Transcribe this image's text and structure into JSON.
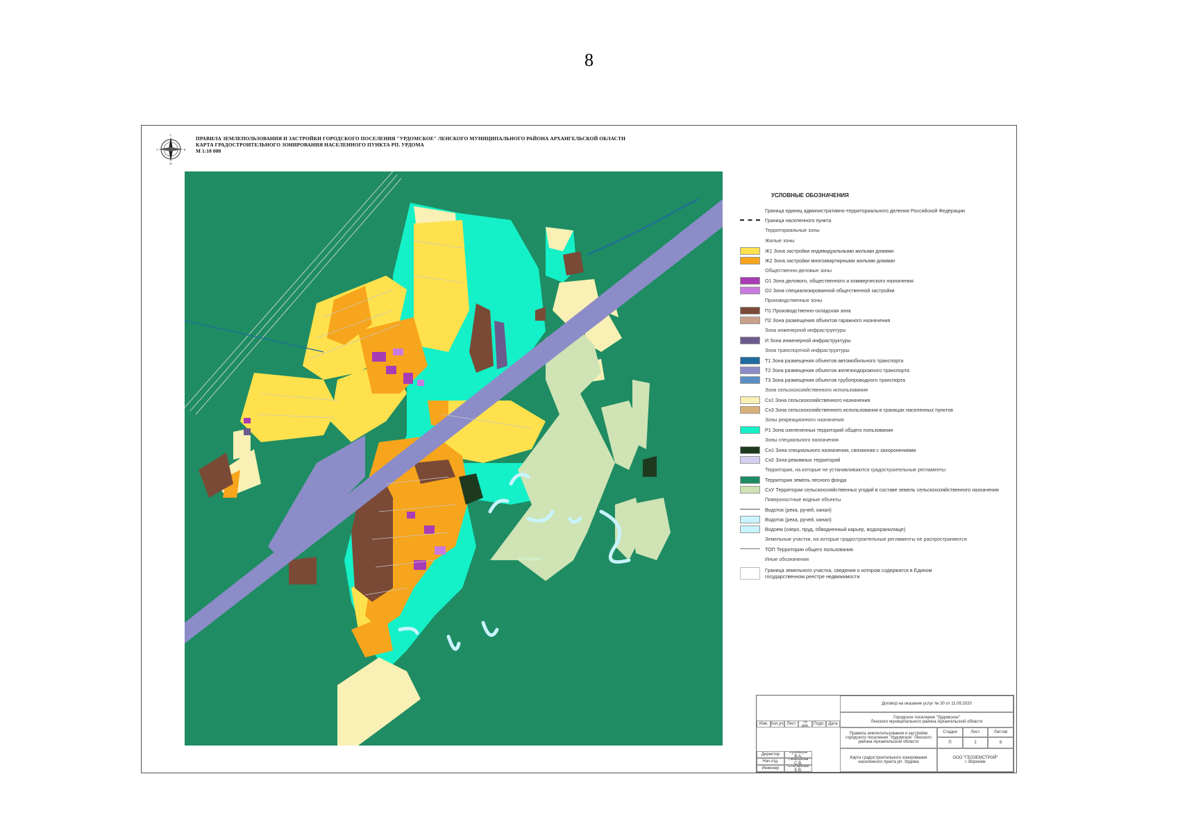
{
  "page_number": "8",
  "title_block": {
    "line1": "ПРАВИЛА ЗЕМЛЕПОЛЬЗОВАНИЯ И ЗАСТРОЙКИ ГОРОДСКОГО ПОСЕЛЕНИЯ \"УРДОМСКОЕ\" ЛЕНСКОГО МУНИЦИПАЛЬНОГО РАЙОНА АРХАНГЕЛЬСКОЙ ОБЛАСТИ",
    "line2": "КАРТА ГРАДОСТРОИТЕЛЬНОГО ЗОНИРОВАНИЯ НАСЕЛЕННОГО ПУНКТА РП. УРДОМА",
    "line3": "М 1:10 000"
  },
  "compass": {
    "n": "С",
    "s": "Ю",
    "e": "В",
    "w": "З"
  },
  "map_labels": {
    "river": "пос.Урдома"
  },
  "legend": {
    "title": "УСЛОВНЫЕ ОБОЗНАЧЕНИЯ",
    "rows": [
      {
        "kind": "line",
        "style": "admin",
        "text": "Граница единиц административно-территориального деления Российской Федерации"
      },
      {
        "kind": "line",
        "style": "settlement",
        "text": "Граница населенного пункта"
      },
      {
        "kind": "head",
        "text": "Территориальные зоны"
      },
      {
        "kind": "head",
        "text": "Жилые зоны"
      },
      {
        "kind": "swatch",
        "color": "#ffe14d",
        "text": "Ж1 Зона застройки индивидуальными жилыми домами"
      },
      {
        "kind": "swatch",
        "color": "#f7a51c",
        "text": "Ж2 Зона застройки многоквартирными жилыми домами"
      },
      {
        "kind": "head",
        "text": "Общественно-деловые зоны"
      },
      {
        "kind": "swatch",
        "color": "#a83cb4",
        "text": "О1 Зона делового, общественного и коммерческого назначения"
      },
      {
        "kind": "swatch",
        "color": "#c97ae0",
        "text": "О2 Зона специализированной общественной застройки"
      },
      {
        "kind": "head",
        "text": "Производственные зоны"
      },
      {
        "kind": "swatch",
        "color": "#7a4a36",
        "text": "П1 Производственно-складская зона"
      },
      {
        "kind": "swatch",
        "color": "#c9a088",
        "text": "П2 Зона размещения объектов гаражного назначения"
      },
      {
        "kind": "head",
        "text": "Зона инженерной инфраструктуры"
      },
      {
        "kind": "swatch",
        "color": "#6b5b8c",
        "text": "И Зона инженерной инфраструктуры"
      },
      {
        "kind": "head",
        "text": "Зона транспортной инфраструктуры"
      },
      {
        "kind": "swatch",
        "color": "#1f6b9e",
        "text": "Т1 Зона размещения объектов автомобильного транспорта"
      },
      {
        "kind": "swatch",
        "color": "#8c8cc8",
        "text": "Т2 Зона размещения объектов железнодорожного транспорта"
      },
      {
        "kind": "swatch",
        "color": "#5b8fc4",
        "text": "Т3 Зона размещения объектов трубопроводного транспорта"
      },
      {
        "kind": "head",
        "text": "Зона сельскохозяйственного использования"
      },
      {
        "kind": "swatch",
        "color": "#f8f0b4",
        "text": "Сх1 Зона сельскохозяйственного назначения"
      },
      {
        "kind": "swatch",
        "color": "#d8b07a",
        "text": "Сх3 Зона сельскохозяйственного использования в границах населенных пунктов"
      },
      {
        "kind": "head",
        "text": "Зоны рекреационного назначения"
      },
      {
        "kind": "swatch",
        "color": "#14f0c8",
        "text": "Р1 Зона озелененных территорий общего пользования"
      },
      {
        "kind": "head",
        "text": "Зоны специального назначения"
      },
      {
        "kind": "swatch",
        "color": "#1e3a1e",
        "text": "Сн1 Зона специального назначения, связанная с захоронениями"
      },
      {
        "kind": "swatch",
        "color": "#d6d0f0",
        "text": "Сн2 Зона режимных территорий"
      },
      {
        "kind": "head",
        "text": "Территории, на которые не устанавливаются градостроительные регламенты"
      },
      {
        "kind": "swatch",
        "color": "#1f8c63",
        "text": "Территории земель лесного фонда"
      },
      {
        "kind": "swatch",
        "color": "#cfe3b4",
        "text": "СхУ Территории сельскохозяйственных угодий в составе земель сельскохозяйственного назначения"
      },
      {
        "kind": "head",
        "text": "Поверхностные водные объекты"
      },
      {
        "kind": "line",
        "style": "water",
        "text": "Водоток (река, ручей, канал)"
      },
      {
        "kind": "swatch",
        "color": "#c8f4ff",
        "text": "Водоток (река, ручей, канал)"
      },
      {
        "kind": "swatch",
        "color": "#c8f4ff",
        "text": "Водоем (озеро, пруд, обводненный карьер, водохранилище)"
      },
      {
        "kind": "head",
        "text": "Земельные участки, на которые градостроительные регламенты не распространяются"
      },
      {
        "kind": "line",
        "style": "top",
        "text": "ТОП Территории общего пользования"
      },
      {
        "kind": "head",
        "text": "Иные обозначения"
      },
      {
        "kind": "parcel",
        "text": "Граница земельного участка, сведения о котором содержатся в Едином государственном реестре недвижимости"
      }
    ]
  },
  "stamp": {
    "contract": "Договор на оказание услуг № 30 от 11.09.2020",
    "settlement": "Городское поселение \"Урдомское\"",
    "district": "Ленского муниципального района Архангельской области",
    "document": "Правила землепользования и застройки городского поселения \"Урдомское\" Ленского района Архангельской области",
    "stage_h": "Стадия",
    "sheet_h": "Лист",
    "sheets_h": "Листов",
    "stage": "П",
    "sheet": "2",
    "sheets": "8",
    "map_name": "Карта градостроительного зонирования населенного пункта рп. Урдома",
    "org": "ООО \"ГЕОЗЕМСТРОЙ\"",
    "city": "г. Воронеж",
    "hdr": [
      "Изм.",
      "Кол.уч.",
      "Лист",
      "№ док.",
      "Подп.",
      "Дата"
    ],
    "roles": [
      "Директор",
      "Нач.отд.",
      "Инженер"
    ],
    "names": [
      "Кузнецов В.А.",
      "Никишина С.В.",
      "Степанова Е.В."
    ]
  },
  "colors": {
    "forest": "#1f8c63",
    "rec": "#14f0c8",
    "zh1": "#ffe14d",
    "zh2": "#f7a51c",
    "prod": "#7a4a36",
    "rail": "#8c8cc8",
    "agri": "#f8f0b4",
    "agriu": "#cfe3b4",
    "water": "#c8f4ff"
  }
}
